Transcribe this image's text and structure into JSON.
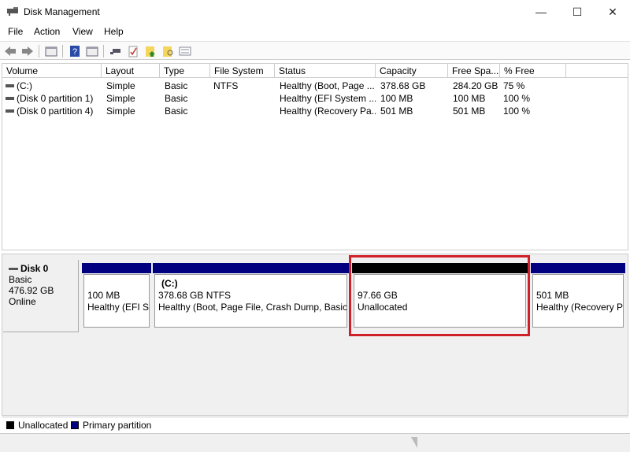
{
  "window": {
    "title": "Disk Management",
    "minimize": "—",
    "maximize": "☐",
    "close": "✕"
  },
  "menu": [
    "File",
    "Action",
    "View",
    "Help"
  ],
  "toolbar": [
    "back-icon",
    "forward-icon",
    "console-tree-icon",
    "help-icon",
    "properties-pane-icon",
    "connect-icon",
    "check-icon",
    "folder-up-icon",
    "folder-search-icon",
    "list-icon"
  ],
  "table": {
    "headers": [
      "Volume",
      "Layout",
      "Type",
      "File System",
      "Status",
      "Capacity",
      "Free Spa...",
      "% Free"
    ],
    "rows": [
      [
        "(C:)",
        "Simple",
        "Basic",
        "NTFS",
        "Healthy (Boot, Page ...",
        "378.68 GB",
        "284.20 GB",
        "75 %"
      ],
      [
        "(Disk 0 partition 1)",
        "Simple",
        "Basic",
        "",
        "Healthy (EFI System ...",
        "100 MB",
        "100 MB",
        "100 %"
      ],
      [
        "(Disk 0 partition 4)",
        "Simple",
        "Basic",
        "",
        "Healthy (Recovery Pa...",
        "501 MB",
        "501 MB",
        "100 %"
      ]
    ]
  },
  "disk": {
    "name": "Disk 0",
    "type": "Basic",
    "size": "476.92 GB",
    "status": "Online",
    "partitions": [
      {
        "title": "",
        "size": "100 MB",
        "status": "Healthy (EFI Sy",
        "kind": "primary"
      },
      {
        "title": "(C:)",
        "size": "378.68 GB NTFS",
        "status": "Healthy (Boot, Page File, Crash Dump, Basic Da",
        "kind": "primary"
      },
      {
        "title": "",
        "size": "97.66 GB",
        "status": "Unallocated",
        "kind": "unallocated"
      },
      {
        "title": "",
        "size": "501 MB",
        "status": "Healthy (Recovery Pa",
        "kind": "primary"
      }
    ]
  },
  "legend": [
    {
      "label": "Unallocated",
      "color": "#000000"
    },
    {
      "label": "Primary partition",
      "color": "#000080"
    }
  ],
  "colors": {
    "primary": "#000080",
    "unallocated": "#000000",
    "highlight": "#d0202a"
  }
}
